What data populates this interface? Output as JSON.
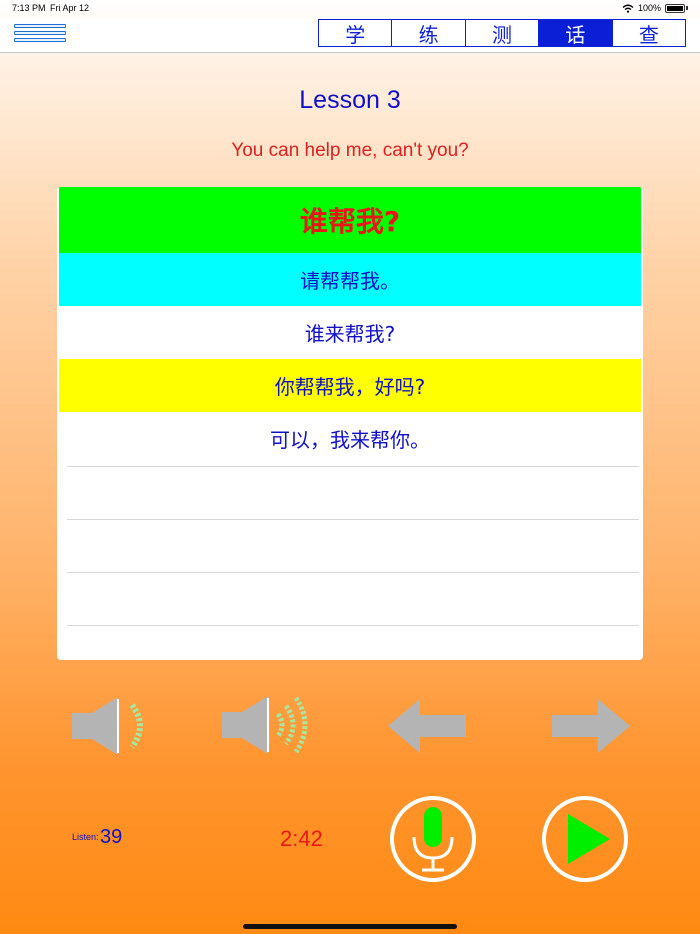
{
  "status_bar": {
    "time": "7:13 PM",
    "date": "Fri Apr 12",
    "battery": "100%"
  },
  "tabs": [
    {
      "label": "学",
      "active": false
    },
    {
      "label": "练",
      "active": false
    },
    {
      "label": "测",
      "active": false
    },
    {
      "label": "话",
      "active": true
    },
    {
      "label": "查",
      "active": false
    }
  ],
  "lesson": {
    "title": "Lesson 3",
    "subtitle": "You can help me, can't you?"
  },
  "dialog": {
    "header": "谁帮我?",
    "lines": [
      "请帮帮我。",
      "谁来帮我?",
      "你帮帮我，好吗?",
      "可以，我来帮你。"
    ]
  },
  "controls": {
    "icons": [
      "speaker-soft-icon",
      "speaker-loud-icon",
      "arrow-left-icon",
      "arrow-right-icon",
      "microphone-icon",
      "play-icon"
    ]
  },
  "stats": {
    "listen_label": "Listen:",
    "listen_count": "39",
    "timer": "2:42"
  },
  "colors": {
    "accent_blue": "#0a1fd6",
    "header_green": "#00ff00",
    "row_cyan": "#00ffff",
    "row_yellow": "#ffff00",
    "timer_red": "#e81818",
    "control_gray": "#b4b4b4",
    "wave_green": "#a8e6a0"
  }
}
